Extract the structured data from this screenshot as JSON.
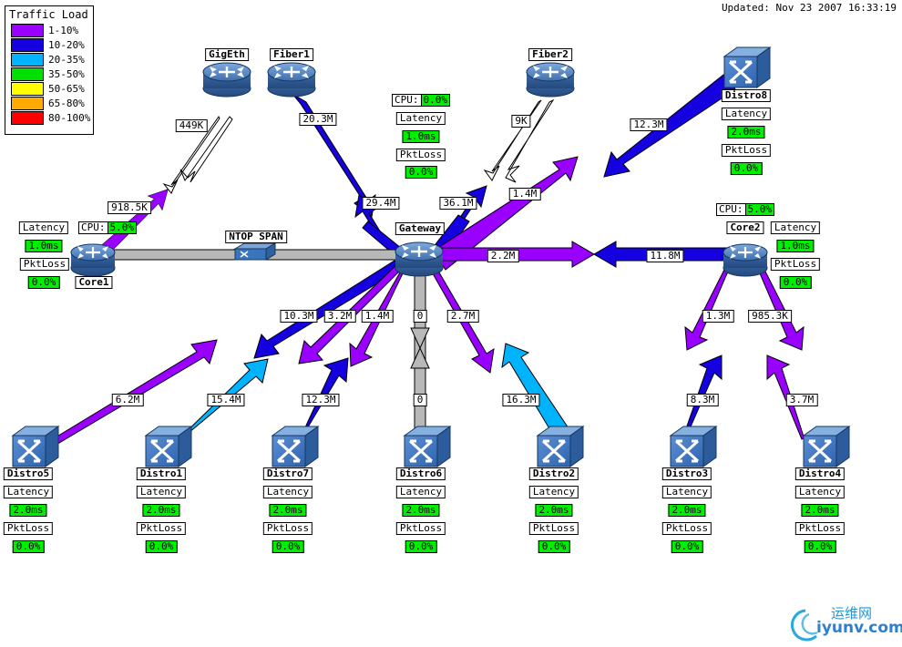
{
  "header": {
    "updated": "Updated: Nov 23 2007 16:33:19"
  },
  "legend": {
    "title": "Traffic Load",
    "items": [
      {
        "range": "1-10%",
        "color": "#9900ff"
      },
      {
        "range": "10-20%",
        "color": "#1500e0"
      },
      {
        "range": "20-35%",
        "color": "#00b3ff"
      },
      {
        "range": "35-50%",
        "color": "#00e000"
      },
      {
        "range": "50-65%",
        "color": "#ffff00"
      },
      {
        "range": "65-80%",
        "color": "#ffaa00"
      },
      {
        "range": "80-100%",
        "color": "#ff0000"
      }
    ]
  },
  "nodes": {
    "gigeth": {
      "name": "GigEth",
      "type": "router"
    },
    "fiber1": {
      "name": "Fiber1",
      "type": "router"
    },
    "fiber2": {
      "name": "Fiber2",
      "type": "router"
    },
    "gateway": {
      "name": "Gateway",
      "type": "router",
      "cpu_label": "CPU:",
      "cpu": "0.0%",
      "latency_label": "Latency",
      "latency": "1.0ms",
      "pktloss_label": "PktLoss",
      "pktloss": "0.0%"
    },
    "core1": {
      "name": "Core1",
      "type": "router",
      "cpu_label": "CPU:",
      "cpu": "5.0%",
      "latency_label": "Latency",
      "latency": "1.0ms",
      "pktloss_label": "PktLoss",
      "pktloss": "0.0%"
    },
    "core2": {
      "name": "Core2",
      "type": "router",
      "cpu_label": "CPU:",
      "cpu": "5.0%",
      "latency_label": "Latency",
      "latency": "1.0ms",
      "pktloss_label": "PktLoss",
      "pktloss": "0.0%"
    },
    "ntop": {
      "name": "NTOP SPAN",
      "type": "span"
    },
    "distro8": {
      "name": "Distro8",
      "type": "switch",
      "latency_label": "Latency",
      "latency": "2.0ms",
      "pktloss_label": "PktLoss",
      "pktloss": "0.0%"
    },
    "distro5": {
      "name": "Distro5",
      "type": "switch",
      "latency_label": "Latency",
      "latency": "2.0ms",
      "pktloss_label": "PktLoss",
      "pktloss": "0.0%"
    },
    "distro1": {
      "name": "Distro1",
      "type": "switch",
      "latency_label": "Latency",
      "latency": "2.0ms",
      "pktloss_label": "PktLoss",
      "pktloss": "0.0%"
    },
    "distro7": {
      "name": "Distro7",
      "type": "switch",
      "latency_label": "Latency",
      "latency": "2.0ms",
      "pktloss_label": "PktLoss",
      "pktloss": "0.0%"
    },
    "distro6": {
      "name": "Distro6",
      "type": "switch",
      "latency_label": "Latency",
      "latency": "2.0ms",
      "pktloss_label": "PktLoss",
      "pktloss": "0.0%"
    },
    "distro2": {
      "name": "Distro2",
      "type": "switch",
      "latency_label": "Latency",
      "latency": "2.0ms",
      "pktloss_label": "PktLoss",
      "pktloss": "0.0%"
    },
    "distro3": {
      "name": "Distro3",
      "type": "switch",
      "latency_label": "Latency",
      "latency": "2.0ms",
      "pktloss_label": "PktLoss",
      "pktloss": "0.0%"
    },
    "distro4": {
      "name": "Distro4",
      "type": "switch",
      "latency_label": "Latency",
      "latency": "2.0ms",
      "pktloss_label": "PktLoss",
      "pktloss": "0.0%"
    }
  },
  "link_labels": {
    "gigeth_down": "449K",
    "gigeth_up": "918.5K",
    "fiber1_down": "20.3M",
    "fiber1_up": "29.4M",
    "fiber2_down": "9K",
    "fiber2_up": "36.1M",
    "distro8_up": "1.4M",
    "distro8_down": "12.3M",
    "core2_out": "2.2M",
    "core2_in": "11.8M",
    "distro5_down": "10.3M",
    "distro5_up": "6.2M",
    "distro1_down": "3.2M",
    "distro1_up": "15.4M",
    "distro7_down": "1.4M",
    "distro7_up": "12.3M",
    "distro6_down": "0",
    "distro6_up": "0",
    "distro2_down": "2.7M",
    "distro2_up": "16.3M",
    "distro3_down": "1.3M",
    "distro3_up": "8.3M",
    "distro4_down": "985.3K",
    "distro4_up": "3.7M"
  },
  "watermark": {
    "cn": "运维网",
    "domain": "iyunv.com"
  }
}
